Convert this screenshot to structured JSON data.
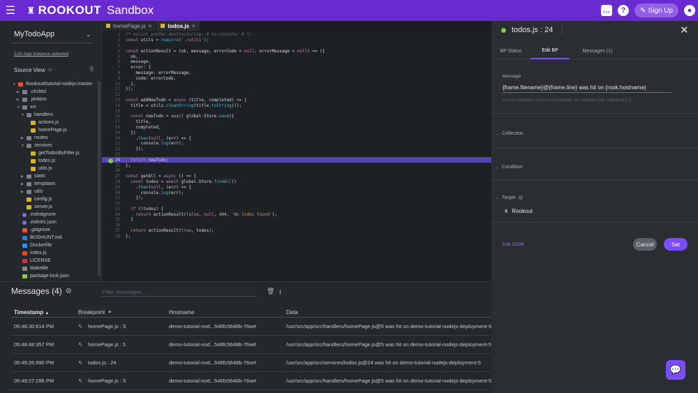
{
  "topbar": {
    "brand": "ROOKOUT",
    "environment": "Sandbox",
    "signup_label": "Sign Up",
    "accent": "#6a2ad1"
  },
  "left": {
    "app_name": "MyTodoApp",
    "instance_link": "1/10 App Instance selected",
    "source_view": "Source View",
    "tree": [
      {
        "label": "Rookout/tutorial-nodejs:master",
        "depth": 0,
        "type": "git",
        "arrow": "down"
      },
      {
        "label": ".circleci",
        "depth": 1,
        "type": "folder",
        "arrow": "right"
      },
      {
        "label": ".jenkins",
        "depth": 1,
        "type": "folder",
        "arrow": "right"
      },
      {
        "label": "src",
        "depth": 1,
        "type": "folder",
        "arrow": "down"
      },
      {
        "label": "handlers",
        "depth": 2,
        "type": "folder",
        "arrow": "down"
      },
      {
        "label": "actions.js",
        "depth": 3,
        "type": "js",
        "arrow": ""
      },
      {
        "label": "homePage.js",
        "depth": 3,
        "type": "js",
        "arrow": ""
      },
      {
        "label": "routes",
        "depth": 2,
        "type": "folder",
        "arrow": "right"
      },
      {
        "label": "services",
        "depth": 2,
        "type": "folder",
        "arrow": "down"
      },
      {
        "label": "getTodosByFilter.js",
        "depth": 3,
        "type": "js",
        "arrow": ""
      },
      {
        "label": "todos.js",
        "depth": 3,
        "type": "js",
        "arrow": ""
      },
      {
        "label": "utils.js",
        "depth": 3,
        "type": "js",
        "arrow": ""
      },
      {
        "label": "static",
        "depth": 2,
        "type": "folder",
        "arrow": "right"
      },
      {
        "label": "templates",
        "depth": 2,
        "type": "folder",
        "arrow": "right"
      },
      {
        "label": "utils",
        "depth": 2,
        "type": "folder",
        "arrow": "right"
      },
      {
        "label": "config.js",
        "depth": 2,
        "type": "js",
        "arrow": ""
      },
      {
        "label": "server.js",
        "depth": 2,
        "type": "js",
        "arrow": ""
      },
      {
        "label": ".eslintignore",
        "depth": 1,
        "type": "dot",
        "arrow": ""
      },
      {
        "label": ".eslintrc.json",
        "depth": 1,
        "type": "dot",
        "arrow": ""
      },
      {
        "label": ".gitignore",
        "depth": 1,
        "type": "git",
        "arrow": ""
      },
      {
        "label": "BUGHUNT.md",
        "depth": 1,
        "type": "md",
        "arrow": ""
      },
      {
        "label": "Dockerfile",
        "depth": 1,
        "type": "docker",
        "arrow": ""
      },
      {
        "label": "index.js",
        "depth": 1,
        "type": "html",
        "arrow": ""
      },
      {
        "label": "LICENSE",
        "depth": 1,
        "type": "lic",
        "arrow": ""
      },
      {
        "label": "Makefile",
        "depth": 1,
        "type": "make",
        "arrow": ""
      },
      {
        "label": "package-lock.json",
        "depth": 1,
        "type": "pkg",
        "arrow": ""
      }
    ]
  },
  "tabs": [
    {
      "label": "homePage.js",
      "active": false
    },
    {
      "label": "todos.js",
      "active": true
    }
  ],
  "code": [
    "/* eslint prefer-destructuring: 0 no-console: 0 */",
    "const utils = require('./utils');",
    "",
    "const actionResult = (ok, message, errorCode = null, errorMessage = null) => ({",
    "  ok,",
    "  message,",
    "  error: {",
    "    message: errorMessage,",
    "    code: errorCode,",
    "  },",
    "});",
    "",
    "const addNewTodo = async (title, completed) => {",
    "  title = utils.cleanString(title.toString());",
    "",
    "  const newTodo = await global.Store.save({",
    "    title,",
    "    completed,",
    "  })",
    "    .then(null, (err) => {",
    "      console.log(err);",
    "    });",
    "",
    "  return newTodo;",
    "};",
    "",
    "const getAll = async () => {",
    "  const todos = await global.Store.findAll()",
    "    .then(null, (err) => {",
    "      console.log(err);",
    "    });",
    "",
    "  if (!todos) {",
    "    return actionResult(false, null, 404, 'No todos found');",
    "  }",
    "",
    "  return actionResult(true, todos);",
    "};"
  ],
  "highlight_line": 24,
  "messages": {
    "title": "Messages (4)",
    "filter_placeholder": "Filter messages...",
    "columns": [
      "Timestamp",
      "Breakpoint",
      "Hostname",
      "Data"
    ],
    "rows": [
      {
        "time": "05:48:30:614 PM",
        "bp": "homePage.js : 5",
        "host": "demo-tutorial-nod...546fc5648b-76wrt",
        "data": "/usr/src/app/src/handlers/homePage.js@5 was hit on demo-tutorial-nodejs-deployment-5"
      },
      {
        "time": "05:48:48:357 PM",
        "bp": "homePage.js : 5",
        "host": "demo-tutorial-nod...546fc5648b-76wrt",
        "data": "/usr/src/app/src/handlers/homePage.js@5 was hit on demo-tutorial-nodejs-deployment-5"
      },
      {
        "time": "05:49:26:990 PM",
        "bp": "todos.js : 24",
        "host": "demo-tutorial-nod...546fc5648b-76wrt",
        "data": "/usr/src/app/src/services/todos.js@24 was hit on demo-tutorial-nodejs-deployment-5"
      },
      {
        "time": "05:49:27:286 PM",
        "bp": "homePage.js : 5",
        "host": "demo-tutorial-nod...546fc5648b-76wrt",
        "data": "/usr/src/app/src/handlers/homePage.js@5 was hit on demo-tutorial-nodejs-deployment-5"
      }
    ]
  },
  "right": {
    "bp_title": "todos.js : 24",
    "tabs": [
      "BP Status",
      "Edit BP",
      "Messages (1)"
    ],
    "message_label": "Message",
    "message_value": "{frame.filename}@{frame.line} was hit on {rook.hostname}",
    "message_hint": "Access variables using curly brackets, for example {var.collection[1].f}",
    "collection": "Collection",
    "condition": "Condition",
    "target": "Target",
    "target_item": "Rookout",
    "edit_json": "Edit JSON",
    "cancel": "Cancel",
    "set": "Set"
  }
}
